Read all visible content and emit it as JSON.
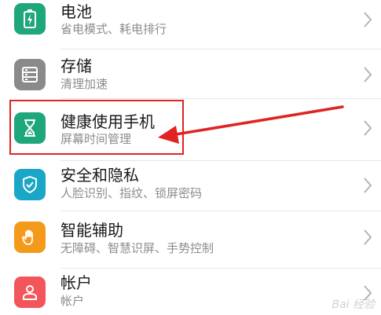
{
  "settings_items": [
    {
      "title": "电池",
      "subtitle": "省电模式、耗电排行",
      "icon": "battery-icon",
      "icon_color": "#1ea77a"
    },
    {
      "title": "存储",
      "subtitle": "清理加速",
      "icon": "storage-icon",
      "icon_color": "#8a8a8a"
    },
    {
      "title": "健康使用手机",
      "subtitle": "屏幕时间管理",
      "icon": "hourglass-icon",
      "icon_color": "#1ea77a"
    },
    {
      "title": "安全和隐私",
      "subtitle": "人脸识别、指纹、锁屏密码",
      "icon": "shield-icon",
      "icon_color": "#1aa6c6"
    },
    {
      "title": "智能辅助",
      "subtitle": "无障碍、智慧识屏、手势控制",
      "icon": "hand-icon",
      "icon_color": "#f39a1a"
    },
    {
      "title": "帐户",
      "subtitle": "帐户",
      "icon": "account-icon",
      "icon_color": "#f2555a"
    }
  ],
  "annotation": {
    "color": "#e02323"
  },
  "watermark": {
    "text": "Bai 经验"
  }
}
